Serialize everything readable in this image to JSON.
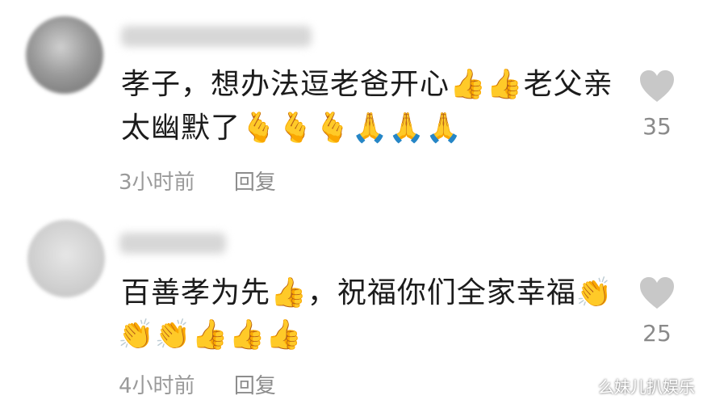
{
  "comments": [
    {
      "line1": "孝子，想办法逗老爸开心👍👍老父亲",
      "line2": "太幽默了🫰🫰🫰🙏🙏🙏",
      "time": "3小时前",
      "reply_label": "回复",
      "like_count": "35",
      "icons": [
        "thumbs-up-emoji",
        "heart-hand-emoji",
        "folded-hands-emoji"
      ]
    },
    {
      "line1": "百善孝为先👍，祝福你们全家幸福👏",
      "line2": "👏👏👍👍👍",
      "time": "4小时前",
      "reply_label": "回复",
      "like_count": "25",
      "icons": [
        "thumbs-up-emoji",
        "clapping-hands-emoji"
      ]
    }
  ],
  "watermark": "么妹儿扒娱乐",
  "colors": {
    "text": "#1b1b1b",
    "meta": "#9a9a9a",
    "heart": "#c8c8c8"
  }
}
